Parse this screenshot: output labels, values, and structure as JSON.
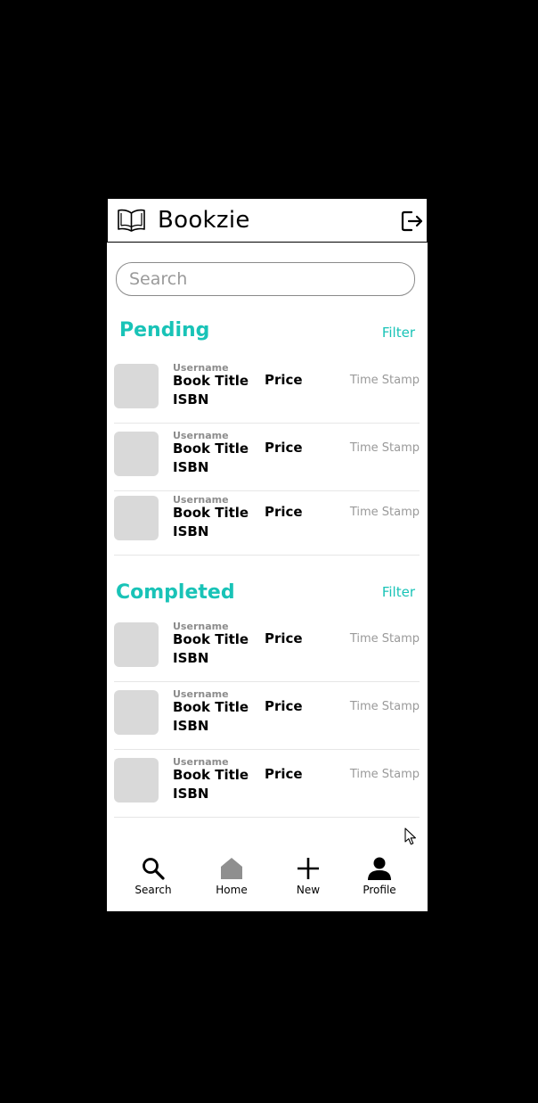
{
  "app": {
    "title": "Bookzie",
    "logo_icon": "open-book-icon",
    "logout_icon": "logout-icon"
  },
  "search": {
    "placeholder": "Search",
    "value": ""
  },
  "sections": [
    {
      "title": "Pending",
      "filter_label": "Filter",
      "rows": [
        {
          "username": "Username",
          "book_title": "Book Title",
          "isbn": "ISBN",
          "price": "Price",
          "timestamp": "Time Stamp"
        },
        {
          "username": "Username",
          "book_title": "Book Title",
          "isbn": "ISBN",
          "price": "Price",
          "timestamp": "Time Stamp"
        },
        {
          "username": "Username",
          "book_title": "Book Title",
          "isbn": "ISBN",
          "price": "Price",
          "timestamp": "Time Stamp"
        }
      ]
    },
    {
      "title": "Completed",
      "filter_label": "Filter",
      "rows": [
        {
          "username": "Username",
          "book_title": "Book Title",
          "isbn": "ISBN",
          "price": "Price",
          "timestamp": "Time Stamp"
        },
        {
          "username": "Username",
          "book_title": "Book Title",
          "isbn": "ISBN",
          "price": "Price",
          "timestamp": "Time Stamp"
        },
        {
          "username": "Username",
          "book_title": "Book Title",
          "isbn": "ISBN",
          "price": "Price",
          "timestamp": "Time Stamp"
        }
      ]
    }
  ],
  "nav": {
    "items": [
      {
        "label": "Search",
        "icon": "search-icon"
      },
      {
        "label": "Home",
        "icon": "home-icon"
      },
      {
        "label": "New",
        "icon": "plus-icon"
      },
      {
        "label": "Profile",
        "icon": "person-icon"
      }
    ]
  },
  "colors": {
    "accent": "#19c3b7",
    "thumbnail": "#d9d9d9",
    "muted_text": "#9a9a9a",
    "home_icon_inactive": "#8f8f8f"
  }
}
